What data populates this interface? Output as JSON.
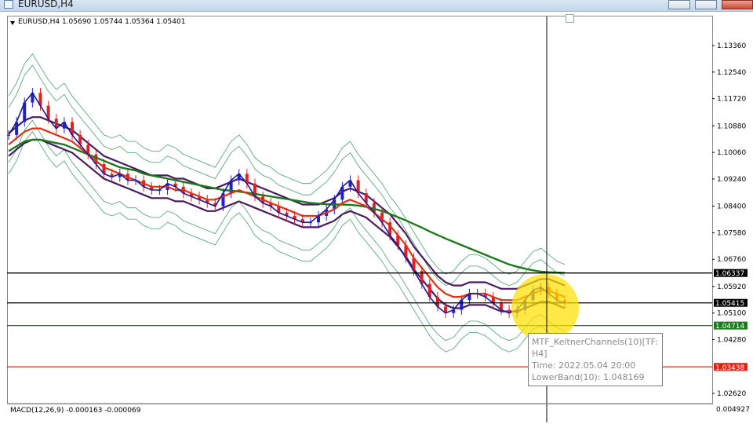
{
  "window": {
    "title": "EURUSD,H4"
  },
  "chart_header": {
    "text": "EURUSD,H4  1.05690 1.05744 1.05364 1.05401"
  },
  "price_axis": {
    "ticks": [
      "1.13360",
      "1.12540",
      "1.11720",
      "1.10880",
      "1.10060",
      "1.09240",
      "1.08400",
      "1.07580",
      "1.06760",
      "1.05920",
      "1.05100",
      "1.04280",
      "1.02620"
    ],
    "ticks_values": [
      1.1336,
      1.1254,
      1.1172,
      1.1088,
      1.1006,
      1.0924,
      1.084,
      1.0758,
      1.0676,
      1.0592,
      1.051,
      1.0428,
      1.0262
    ]
  },
  "levels": [
    {
      "label": "1.06337",
      "value": 1.06337,
      "line_color": "#000000",
      "tag_color": "#000000"
    },
    {
      "label": "1.05415",
      "value": 1.05415,
      "line_color": "#000000",
      "tag_color": "#000000"
    },
    {
      "label": "1.04714",
      "value": 1.04714,
      "line_color": "#1b7a1b",
      "tag_color": "#1b7a1b"
    },
    {
      "label": "1.03438",
      "value": 1.03438,
      "line_color": "#e02010",
      "tag_color": "#e02010"
    }
  ],
  "tooltip": {
    "line1": "MTF_KeltnerChannels(10)[TF:",
    "line2": "H4]",
    "line3": "Time: 2022.05.04 20:00",
    "line4": "LowerBand(10): 1.048169"
  },
  "macd": {
    "label": "MACD(12,26,9) -0.000163 -0.000069",
    "axis_value": "0.004927"
  },
  "colors": {
    "highlight": "#ffe000",
    "sma": "#1b7a1b",
    "ema": "#e03010",
    "keltner_mid": "#1a1aa0",
    "keltner_band": "#4a1a60",
    "bollinger": "#4aa06a",
    "bull": "#2020d0",
    "bear": "#e02020"
  },
  "chart_data": {
    "type": "line",
    "title": "EURUSD,H4",
    "ylim": [
      1.0262,
      1.1418
    ],
    "series": [
      {
        "values": [
          1.106,
          1.11,
          1.116,
          1.119,
          1.115,
          1.111,
          1.108,
          1.11,
          1.106,
          1.103,
          1.1,
          1.097,
          1.094,
          1.093,
          1.094,
          1.092,
          1.092,
          1.09,
          1.089,
          1.089,
          1.091,
          1.09,
          1.088,
          1.087,
          1.086,
          1.085,
          1.084,
          1.088,
          1.092,
          1.094,
          1.091,
          1.087,
          1.085,
          1.084,
          1.082,
          1.081,
          1.08,
          1.079,
          1.079,
          1.081,
          1.083,
          1.086,
          1.09,
          1.092,
          1.088,
          1.085,
          1.082,
          1.079,
          1.075,
          1.072,
          1.068,
          1.064,
          1.06,
          1.056,
          1.053,
          1.051,
          1.052,
          1.055,
          1.057,
          1.057,
          1.056,
          1.054,
          1.052,
          1.051,
          1.052,
          1.055,
          1.058,
          1.059,
          1.057,
          1.055,
          1.054
        ]
      },
      {
        "values": [
          1.103,
          1.105,
          1.107,
          1.108,
          1.108,
          1.107,
          1.106,
          1.105,
          1.104,
          1.102,
          1.1,
          1.098,
          1.096,
          1.095,
          1.094,
          1.093,
          1.092,
          1.091,
          1.09,
          1.09,
          1.09,
          1.089,
          1.089,
          1.088,
          1.087,
          1.086,
          1.086,
          1.087,
          1.088,
          1.089,
          1.088,
          1.087,
          1.086,
          1.085,
          1.084,
          1.083,
          1.082,
          1.081,
          1.081,
          1.081,
          1.082,
          1.083,
          1.085,
          1.086,
          1.085,
          1.084,
          1.082,
          1.08,
          1.078,
          1.075,
          1.072,
          1.068,
          1.065,
          1.062,
          1.059,
          1.057,
          1.056,
          1.056,
          1.057,
          1.057,
          1.057,
          1.056,
          1.055,
          1.055,
          1.055,
          1.056,
          1.057,
          1.058,
          1.058,
          1.057,
          1.056
        ]
      },
      {
        "values": [
          1.101,
          1.1025,
          1.104,
          1.1045,
          1.1045,
          1.104,
          1.1035,
          1.103,
          1.102,
          1.101,
          1.1,
          1.099,
          1.098,
          1.097,
          1.096,
          1.0955,
          1.095,
          1.094,
          1.0935,
          1.093,
          1.0925,
          1.092,
          1.0915,
          1.091,
          1.0905,
          1.09,
          1.0895,
          1.089,
          1.0888,
          1.0885,
          1.0882,
          1.0878,
          1.0874,
          1.087,
          1.0866,
          1.0862,
          1.0858,
          1.0854,
          1.085,
          1.0848,
          1.0846,
          1.0845,
          1.0845,
          1.0844,
          1.0842,
          1.0838,
          1.0832,
          1.0825,
          1.0816,
          1.0806,
          1.0796,
          1.0785,
          1.0774,
          1.0762,
          1.0751,
          1.074,
          1.073,
          1.072,
          1.071,
          1.07,
          1.069,
          1.068,
          1.067,
          1.066,
          1.0653,
          1.0647,
          1.0642,
          1.0638,
          1.0636,
          1.0635,
          1.0634
        ]
      }
    ]
  }
}
